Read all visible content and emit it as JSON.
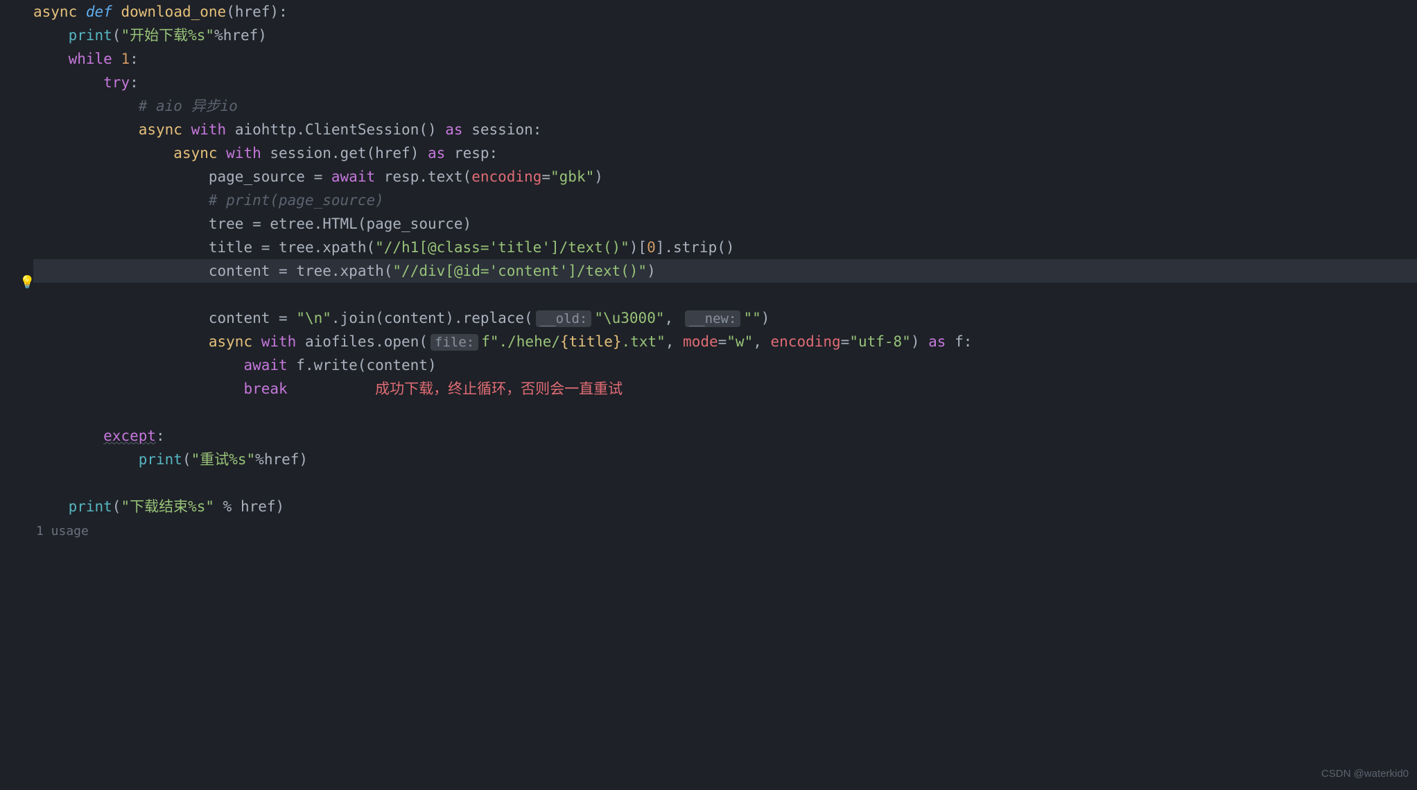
{
  "gutter": {
    "bulb": "💡"
  },
  "code": {
    "l1": {
      "async": "async",
      "def": "def",
      "fn": "download_one",
      "open": "(",
      "param": "href",
      "close": "):"
    },
    "l2": {
      "print": "print",
      "open": "(",
      "str": "\"开始下载%s\"",
      "pct": "%",
      "arg": "href",
      "close": ")"
    },
    "l3": {
      "while": "while",
      "sp": " ",
      "one": "1",
      "colon": ":"
    },
    "l4": {
      "try": "try",
      "colon": ":"
    },
    "l5": {
      "comment": "# aio 异步io"
    },
    "l6": {
      "async": "async",
      "with": "with",
      "mod": "aiohttp.ClientSession()",
      "as": "as",
      "var": "session:"
    },
    "l7": {
      "async": "async",
      "with": "with",
      "call": "session.get(href)",
      "as": "as",
      "var": "resp:"
    },
    "l8": {
      "lhs": "page_source",
      "eq": " = ",
      "await": "await",
      "sp": " ",
      "call": "resp.text(",
      "kwarg": "encoding",
      "eq2": "=",
      "val": "\"gbk\"",
      "close": ")"
    },
    "l9": {
      "comment": "# print(page_source)"
    },
    "l10": {
      "lhs": "tree",
      "eq": " = ",
      "call": "etree.HTML(page_source)"
    },
    "l11": {
      "lhs": "title",
      "eq": " = ",
      "call1": "tree.xpath(",
      "str": "\"//h1[@class='title']/text()\"",
      "close1": ")[",
      "idx": "0",
      "close2": "].strip()"
    },
    "l12": {
      "lhs": "content",
      "eq": " = ",
      "call": "tree.xpath(",
      "str": "\"//div[@id='content']/text()\"",
      "close": ")"
    },
    "l13": {
      "lhs": "content",
      "eq": " = ",
      "str1": "\"\\n\"",
      "join": ".join(content).replace(",
      "inlay1": "__old:",
      "str2": "\"\\u3000\"",
      "comma": ", ",
      "inlay2": "__new:",
      "str3": "\"\"",
      "close": ")"
    },
    "l14": {
      "async": "async",
      "with": "with",
      "call": "aiofiles.open(",
      "inlay": "file:",
      "fpre": "f",
      "str1": "\"./hehe/",
      "expr": "{title}",
      "str2": ".txt\"",
      "comma1": ", ",
      "kwarg1": "mode",
      "eq1": "=",
      "val1": "\"w\"",
      "comma2": ", ",
      "kwarg2": "encoding",
      "eq2": "=",
      "val2": "\"utf-8\"",
      "close": ")",
      "as": "as",
      "var": "f:"
    },
    "l15": {
      "await": "await",
      "call": " f.write(content)"
    },
    "l16": {
      "break": "break",
      "annotation": "成功下载，终止循环，否则会一直重试"
    },
    "l17": {
      "except": "except",
      "colon": ":"
    },
    "l18": {
      "print": "print",
      "open": "(",
      "str": "\"重试%s\"",
      "pct": "%",
      "arg": "href",
      "close": ")"
    },
    "l19": {
      "print": "print",
      "open": "(",
      "str": "\"下载结束%s\"",
      "pct": " % ",
      "arg": "href",
      "close": ")"
    }
  },
  "usage": "1 usage",
  "watermark": "CSDN @waterkid0"
}
